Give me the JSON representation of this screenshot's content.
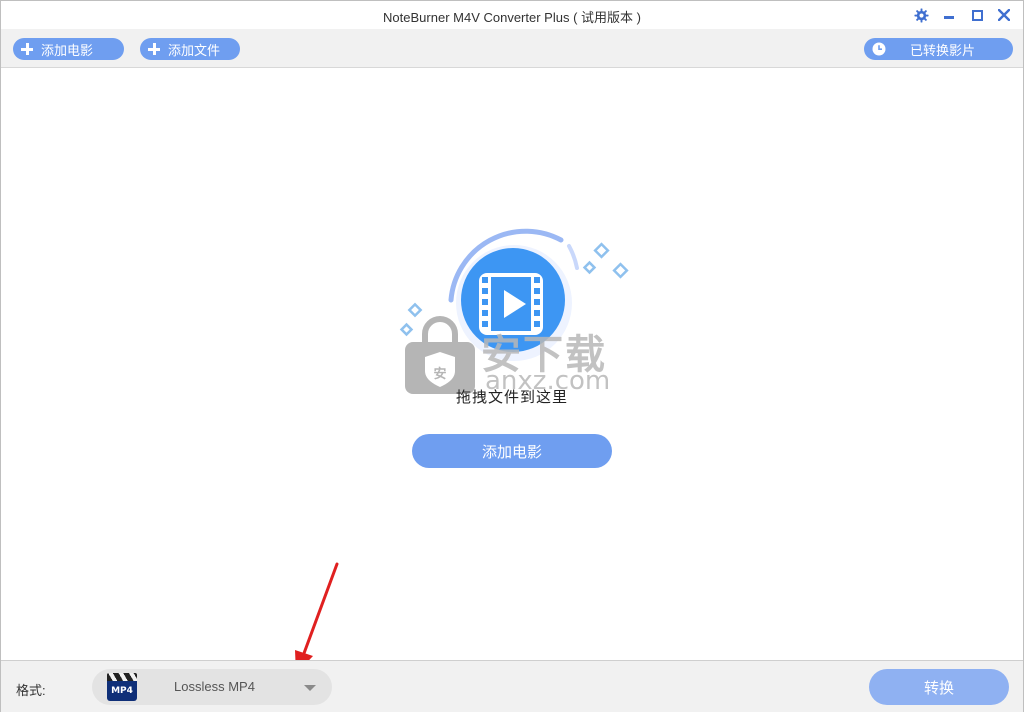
{
  "window": {
    "title": "NoteBurner M4V Converter Plus ( 试用版本 )"
  },
  "toolbar": {
    "add_movie_label": "添加电影",
    "add_file_label": "添加文件",
    "converted_label": "已转换影片"
  },
  "main": {
    "drop_text": "拖拽文件到这里",
    "add_movie_button": "添加电影"
  },
  "watermark": {
    "brand": "安下载",
    "domain": "anxz.com"
  },
  "footer": {
    "format_label": "格式:",
    "format_value": "Lossless MP4",
    "format_icon_text": "MP4",
    "convert_label": "转换"
  },
  "colors": {
    "accent": "#6f9ef0",
    "convert": "#8fb1f2",
    "arrow": "#e02020"
  }
}
